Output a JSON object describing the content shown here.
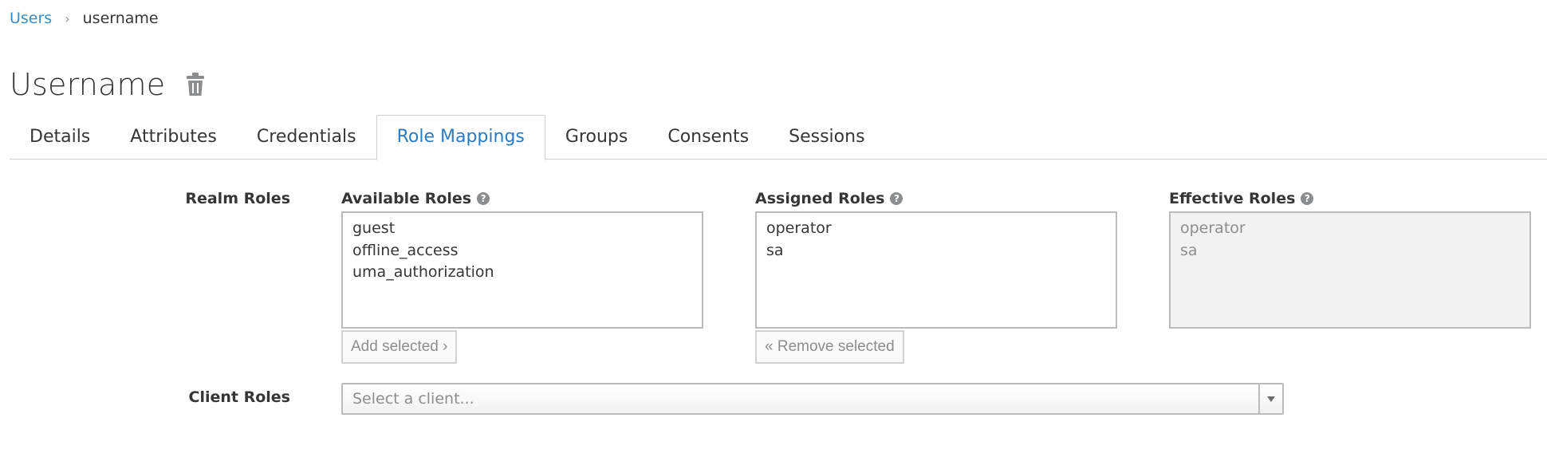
{
  "breadcrumb": {
    "parent": "Users",
    "separator": "›",
    "current": "username"
  },
  "page": {
    "title": "Username",
    "delete_icon": "trash-icon"
  },
  "tabs": [
    {
      "label": "Details",
      "active": false
    },
    {
      "label": "Attributes",
      "active": false
    },
    {
      "label": "Credentials",
      "active": false
    },
    {
      "label": "Role Mappings",
      "active": true
    },
    {
      "label": "Groups",
      "active": false
    },
    {
      "label": "Consents",
      "active": false
    },
    {
      "label": "Sessions",
      "active": false
    }
  ],
  "realm_roles": {
    "label": "Realm Roles",
    "available": {
      "label": "Available Roles",
      "help_icon": "question-circle-icon",
      "items": [
        "guest",
        "offline_access",
        "uma_authorization"
      ]
    },
    "assigned": {
      "label": "Assigned Roles",
      "help_icon": "question-circle-icon",
      "items": [
        "operator",
        "sa"
      ]
    },
    "effective": {
      "label": "Effective Roles",
      "help_icon": "question-circle-icon",
      "items": [
        "operator",
        "sa"
      ]
    },
    "add_button": "Add selected ›",
    "remove_button": "« Remove selected"
  },
  "client_roles": {
    "label": "Client Roles",
    "placeholder": "Select a client..."
  },
  "colors": {
    "link": "#3a8bc6",
    "active_tab": "#2b7cc4",
    "muted": "#8b8d8f"
  }
}
